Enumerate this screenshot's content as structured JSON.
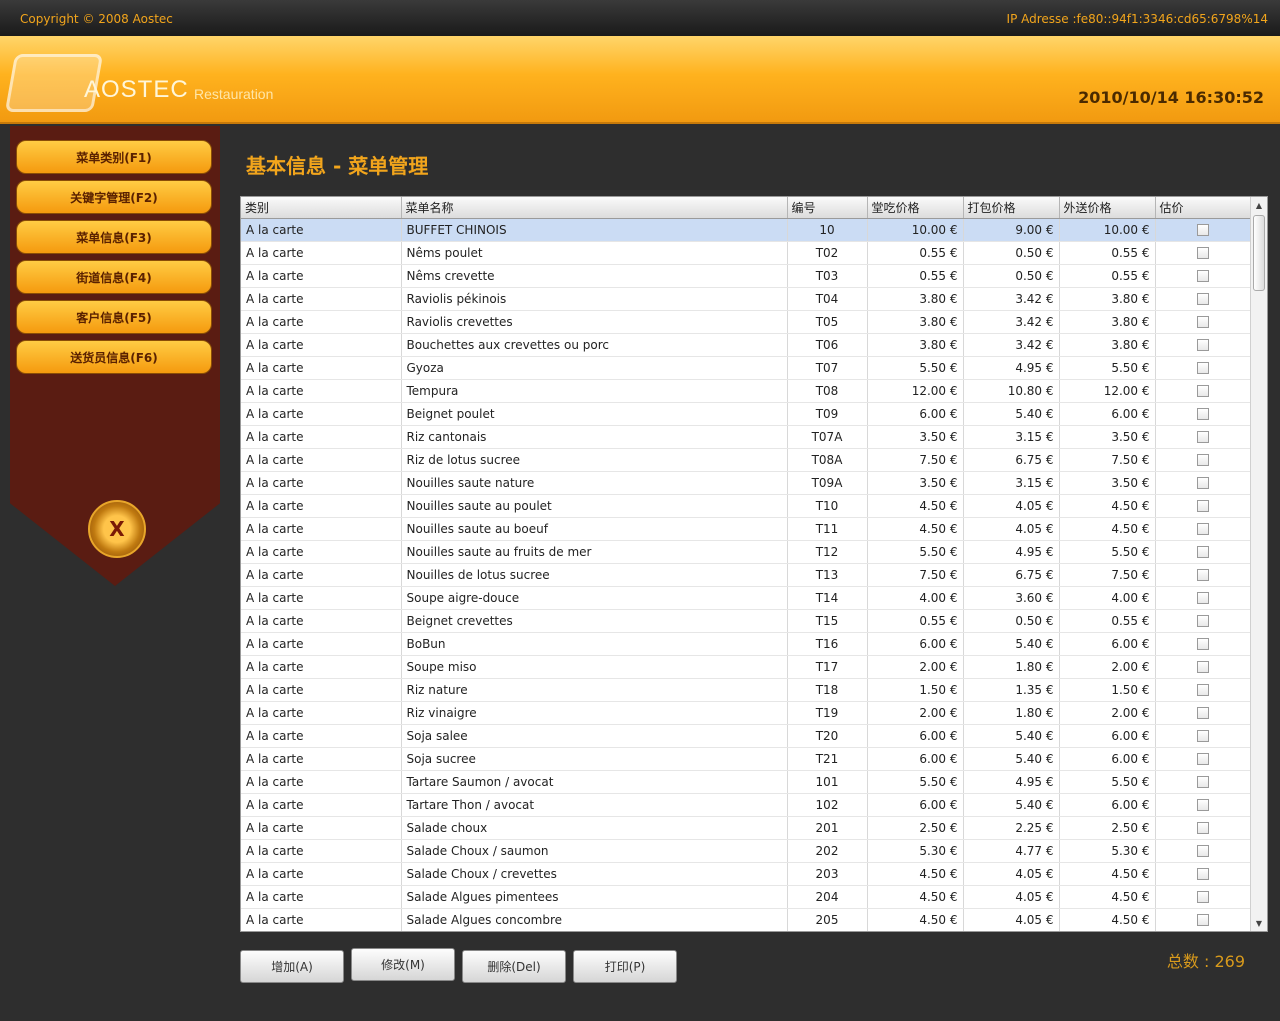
{
  "topbar": {
    "copyright": "Copyright © 2008 Aostec",
    "ip": "IP Adresse :fe80::94f1:3346:cd65:6798%14"
  },
  "header": {
    "logo_text": "AOSTEC",
    "logo_sub": "Restauration",
    "datetime": "2010/10/14 16:30:52"
  },
  "sidebar": {
    "items": [
      {
        "label": "菜单类别(F1)"
      },
      {
        "label": "关键字管理(F2)"
      },
      {
        "label": "菜单信息(F3)"
      },
      {
        "label": "街道信息(F4)"
      },
      {
        "label": "客户信息(F5)"
      },
      {
        "label": "送货员信息(F6)"
      }
    ],
    "exit_label": "X"
  },
  "page_title": "基本信息 - 菜单管理",
  "table": {
    "headers": [
      "类别",
      "菜单名称",
      "编号",
      "堂吃价格",
      "打包价格",
      "外送价格",
      "估价"
    ],
    "rows": [
      [
        "A la carte",
        "BUFFET CHINOIS",
        "10",
        "10.00 €",
        "9.00 €",
        "10.00 €"
      ],
      [
        "A la carte",
        "Nêms poulet",
        "T02",
        "0.55 €",
        "0.50 €",
        "0.55 €"
      ],
      [
        "A la carte",
        "Nêms crevette",
        "T03",
        "0.55 €",
        "0.50 €",
        "0.55 €"
      ],
      [
        "A la carte",
        "Raviolis pékinois",
        "T04",
        "3.80 €",
        "3.42 €",
        "3.80 €"
      ],
      [
        "A la carte",
        "Raviolis crevettes",
        "T05",
        "3.80 €",
        "3.42 €",
        "3.80 €"
      ],
      [
        "A la carte",
        "Bouchettes aux crevettes ou porc",
        "T06",
        "3.80 €",
        "3.42 €",
        "3.80 €"
      ],
      [
        "A la carte",
        "Gyoza",
        "T07",
        "5.50 €",
        "4.95 €",
        "5.50 €"
      ],
      [
        "A la carte",
        "Tempura",
        "T08",
        "12.00 €",
        "10.80 €",
        "12.00 €"
      ],
      [
        "A la carte",
        "Beignet poulet",
        "T09",
        "6.00 €",
        "5.40 €",
        "6.00 €"
      ],
      [
        "A la carte",
        "Riz cantonais",
        "T07A",
        "3.50 €",
        "3.15 €",
        "3.50 €"
      ],
      [
        "A la carte",
        "Riz de lotus sucree",
        "T08A",
        "7.50 €",
        "6.75 €",
        "7.50 €"
      ],
      [
        "A la carte",
        "Nouilles saute nature",
        "T09A",
        "3.50 €",
        "3.15 €",
        "3.50 €"
      ],
      [
        "A la carte",
        "Nouilles saute au poulet",
        "T10",
        "4.50 €",
        "4.05 €",
        "4.50 €"
      ],
      [
        "A la carte",
        "Nouilles saute au boeuf",
        "T11",
        "4.50 €",
        "4.05 €",
        "4.50 €"
      ],
      [
        "A la carte",
        "Nouilles saute au fruits de mer",
        "T12",
        "5.50 €",
        "4.95 €",
        "5.50 €"
      ],
      [
        "A la carte",
        "Nouilles de lotus sucree",
        "T13",
        "7.50 €",
        "6.75 €",
        "7.50 €"
      ],
      [
        "A la carte",
        "Soupe aigre-douce",
        "T14",
        "4.00 €",
        "3.60 €",
        "4.00 €"
      ],
      [
        "A la carte",
        "Beignet crevettes",
        "T15",
        "0.55 €",
        "0.50 €",
        "0.55 €"
      ],
      [
        "A la carte",
        "BoBun",
        "T16",
        "6.00 €",
        "5.40 €",
        "6.00 €"
      ],
      [
        "A la carte",
        "Soupe miso",
        "T17",
        "2.00 €",
        "1.80 €",
        "2.00 €"
      ],
      [
        "A la carte",
        "Riz nature",
        "T18",
        "1.50 €",
        "1.35 €",
        "1.50 €"
      ],
      [
        "A la carte",
        "Riz vinaigre",
        "T19",
        "2.00 €",
        "1.80 €",
        "2.00 €"
      ],
      [
        "A la carte",
        "Soja salee",
        "T20",
        "6.00 €",
        "5.40 €",
        "6.00 €"
      ],
      [
        "A la carte",
        "Soja sucree",
        "T21",
        "6.00 €",
        "5.40 €",
        "6.00 €"
      ],
      [
        "A la carte",
        "Tartare Saumon / avocat",
        "101",
        "5.50 €",
        "4.95 €",
        "5.50 €"
      ],
      [
        "A la carte",
        "Tartare Thon / avocat",
        "102",
        "6.00 €",
        "5.40 €",
        "6.00 €"
      ],
      [
        "A la carte",
        "Salade choux",
        "201",
        "2.50 €",
        "2.25 €",
        "2.50 €"
      ],
      [
        "A la carte",
        "Salade Choux / saumon",
        "202",
        "5.30 €",
        "4.77 €",
        "5.30 €"
      ],
      [
        "A la carte",
        "Salade Choux / crevettes",
        "203",
        "4.50 €",
        "4.05 €",
        "4.50 €"
      ],
      [
        "A la carte",
        "Salade Algues pimentees",
        "204",
        "4.50 €",
        "4.05 €",
        "4.50 €"
      ],
      [
        "A la carte",
        "Salade Algues concombre",
        "205",
        "4.50 €",
        "4.05 €",
        "4.50 €"
      ]
    ]
  },
  "buttons": {
    "add": "增加(A)",
    "modify": "修改(M)",
    "delete": "删除(Del)",
    "print": "打印(P)"
  },
  "total_text": "总数 : 269"
}
